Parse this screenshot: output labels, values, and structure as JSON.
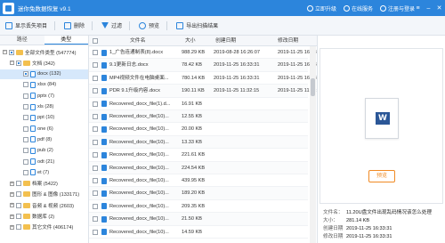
{
  "app": {
    "title": "迷你兔数据恢复 v9.1"
  },
  "title_actions": [
    "立即升级",
    "在线服务",
    "注册与登录"
  ],
  "toolbar": [
    "显示丢失项目",
    "删除",
    "过滤",
    "预览",
    "导出扫描结果"
  ],
  "left_tabs": [
    "路径",
    "类型"
  ],
  "tree": [
    {
      "label": "全部文件类型 (547774)",
      "level": 0
    },
    {
      "label": "文档 (342)",
      "level": 1
    },
    {
      "label": "docx (132)",
      "level": 2,
      "selected": true
    },
    {
      "label": "xlsx (84)",
      "level": 2
    },
    {
      "label": "pptx (7)",
      "level": 2
    },
    {
      "label": "xls (28)",
      "level": 2
    },
    {
      "label": "ppt (10)",
      "level": 2
    },
    {
      "label": "one (6)",
      "level": 2
    },
    {
      "label": "pdf (8)",
      "level": 2
    },
    {
      "label": "pub (2)",
      "level": 2
    },
    {
      "label": "odt (21)",
      "level": 2
    },
    {
      "label": "et (7)",
      "level": 2
    },
    {
      "label": "档案 (5422)",
      "level": 1
    },
    {
      "label": "图形 & 图像 (133171)",
      "level": 1
    },
    {
      "label": "音频 & 视频 (2603)",
      "level": 1
    },
    {
      "label": "数据库 (2)",
      "level": 1
    },
    {
      "label": "其它文件 (406174)",
      "level": 1
    }
  ],
  "columns": [
    "文件名",
    "大小",
    "创建日期",
    "修改日期"
  ],
  "files": [
    {
      "name": "1_广告连通制表(8).docx",
      "size": "988.29 KB",
      "created": "2019-08-28 16:26:07",
      "modified": "2019-11-25 16:33:31"
    },
    {
      "name": "9.1更新日志.docx",
      "size": "78.42 KB",
      "created": "2019-11-25 16:33:31",
      "modified": "2019-11-25 16:33:31"
    },
    {
      "name": "MP4视频文件在电脑桌面...",
      "size": "780.14 KB",
      "created": "2019-11-25 16:33:31",
      "modified": "2019-11-25 16:33:31"
    },
    {
      "name": "PDR 9.1升级内容.docx",
      "size": "190.11 KB",
      "created": "2019-11-25 11:32:15",
      "modified": "2019-11-25 11:32:15"
    },
    {
      "name": "Recovered_docx_file(1).d...",
      "size": "16.91 KB",
      "created": "",
      "modified": ""
    },
    {
      "name": "Recovered_docx_file(10)...",
      "size": "12.55 KB",
      "created": "",
      "modified": ""
    },
    {
      "name": "Recovered_docx_file(10)...",
      "size": "20.00 KB",
      "created": "",
      "modified": ""
    },
    {
      "name": "Recovered_docx_file(10)...",
      "size": "13.33 KB",
      "created": "",
      "modified": ""
    },
    {
      "name": "Recovered_docx_file(10)...",
      "size": "221.61 KB",
      "created": "",
      "modified": ""
    },
    {
      "name": "Recovered_docx_file(10)...",
      "size": "224.54 KB",
      "created": "",
      "modified": ""
    },
    {
      "name": "Recovered_docx_file(10)...",
      "size": "439.95 KB",
      "created": "",
      "modified": ""
    },
    {
      "name": "Recovered_docx_file(10)...",
      "size": "189.20 KB",
      "created": "",
      "modified": ""
    },
    {
      "name": "Recovered_docx_file(10)...",
      "size": "209.35 KB",
      "created": "",
      "modified": ""
    },
    {
      "name": "Recovered_docx_file(10)...",
      "size": "21.50 KB",
      "created": "",
      "modified": ""
    },
    {
      "name": "Recovered_docx_file(10)...",
      "size": "14.59 KB",
      "created": "",
      "modified": ""
    }
  ],
  "preview": {
    "button": "预览",
    "info": [
      {
        "k": "文件名：",
        "v": "11.20U盘文件出现乱码情况该怎么处理"
      },
      {
        "k": "大小：",
        "v": "281.14 KB"
      },
      {
        "k": "创建日期",
        "v": "2019-11-25 16:33:31"
      },
      {
        "k": "修改日期",
        "v": "2019-11-25 16:33:31"
      }
    ]
  },
  "colors": {
    "accent": "#2c85dc",
    "orange": "#f08a24"
  }
}
